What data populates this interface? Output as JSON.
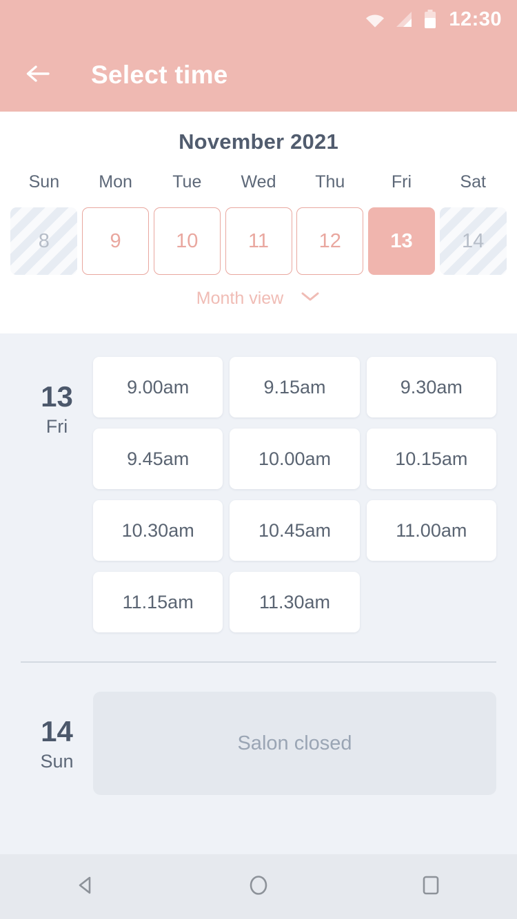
{
  "status_bar": {
    "time": "12:30",
    "icons": [
      "wifi-icon",
      "cellular-signal-icon",
      "battery-icon"
    ]
  },
  "app_bar": {
    "back_icon": "back-arrow-icon",
    "title": "Select time"
  },
  "calendar": {
    "month_title": "November 2021",
    "day_names": [
      "Sun",
      "Mon",
      "Tue",
      "Wed",
      "Thu",
      "Fri",
      "Sat"
    ],
    "days": [
      {
        "number": "8",
        "state": "disabled"
      },
      {
        "number": "9",
        "state": "available"
      },
      {
        "number": "10",
        "state": "available"
      },
      {
        "number": "11",
        "state": "available"
      },
      {
        "number": "12",
        "state": "available"
      },
      {
        "number": "13",
        "state": "selected"
      },
      {
        "number": "14",
        "state": "disabled"
      }
    ],
    "view_toggle_label": "Month view",
    "view_toggle_icon": "chevron-down-icon"
  },
  "schedule": [
    {
      "day_number": "13",
      "day_name": "Fri",
      "slots": [
        "9.00am",
        "9.15am",
        "9.30am",
        "9.45am",
        "10.00am",
        "10.15am",
        "10.30am",
        "10.45am",
        "11.00am",
        "11.15am",
        "11.30am"
      ]
    },
    {
      "day_number": "14",
      "day_name": "Sun",
      "closed_message": "Salon closed"
    }
  ],
  "nav_bar": {
    "back": "nav-back-icon",
    "home": "nav-home-icon",
    "recents": "nav-recents-icon"
  },
  "colors": {
    "brand_pink": "#efb9b2",
    "selected_pink": "#f0b5ae",
    "outline_pink": "#e9a79f",
    "toggle_pink": "#f0bcb5",
    "page_bg": "#eff2f7",
    "card_white": "#ffffff",
    "text_slate": "#4c586b",
    "text_muted": "#5d6878",
    "closed_card": "#e4e8ee",
    "closed_text": "#9aa5b4",
    "disabled_cell": "#e7ecf3",
    "nav_bg": "#e6e9ee"
  }
}
